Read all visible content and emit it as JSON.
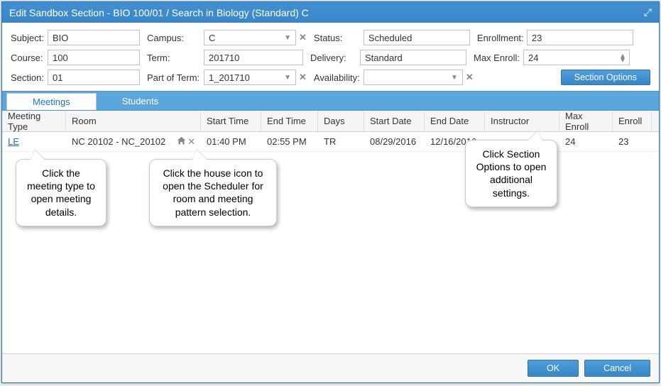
{
  "title": "Edit Sandbox Section - BIO 100/01 / Search in Biology (Standard) C",
  "labels": {
    "subject": "Subject:",
    "course": "Course:",
    "section": "Section:",
    "campus": "Campus:",
    "term": "Term:",
    "part_of_term": "Part of Term:",
    "status": "Status:",
    "delivery": "Delivery:",
    "availability": "Availability:",
    "enrollment": "Enrollment:",
    "max_enroll": "Max Enroll:"
  },
  "values": {
    "subject": "BIO",
    "course": "100",
    "section": "01",
    "campus": "C",
    "term": "201710",
    "part_of_term": "1_201710",
    "status": "Scheduled",
    "delivery": "Standard",
    "availability": "",
    "enrollment": "23",
    "max_enroll": "24"
  },
  "buttons": {
    "section_options": "Section Options",
    "ok": "OK",
    "cancel": "Cancel"
  },
  "tabs": {
    "meetings": "Meetings",
    "students": "Students"
  },
  "grid": {
    "headers": {
      "meeting_type": "Meeting Type",
      "room": "Room",
      "start_time": "Start Time",
      "end_time": "End Time",
      "days": "Days",
      "start_date": "Start Date",
      "end_date": "End Date",
      "instructor": "Instructor",
      "max_enroll": "Max Enroll",
      "enroll": "Enroll"
    },
    "rows": [
      {
        "meeting_type": "LE",
        "room": "NC 20102 - NC_20102",
        "start_time": "01:40 PM",
        "end_time": "02:55 PM",
        "days": "TR",
        "start_date": "08/29/2016",
        "end_date": "12/16/2016",
        "instructor": "",
        "max_enroll": "24",
        "enroll": "23"
      }
    ]
  },
  "callouts": {
    "c1": "Click the meeting type to open meeting details.",
    "c2": "Click the house icon to open the Scheduler for room and meeting pattern selection.",
    "c3": "Click Section Options to open additional settings."
  }
}
